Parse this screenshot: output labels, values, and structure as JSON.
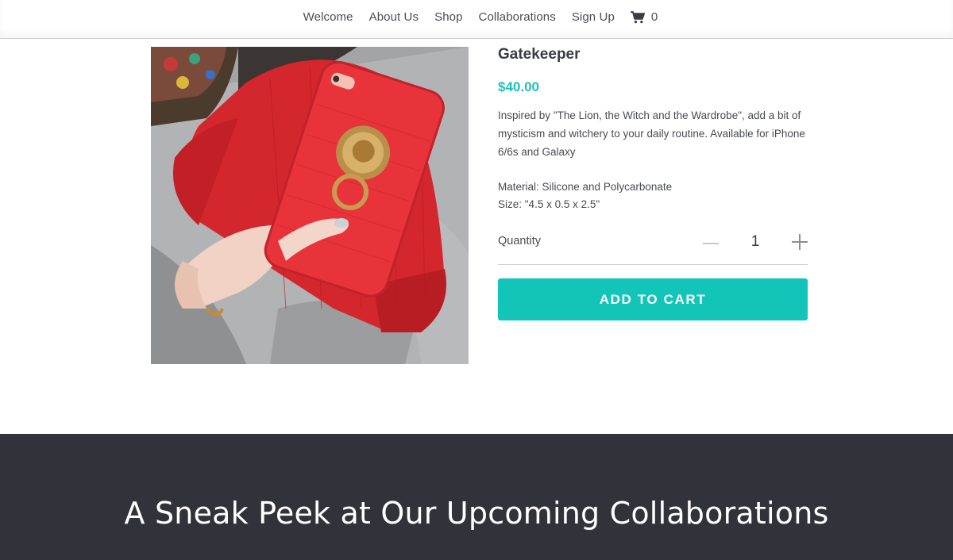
{
  "nav": {
    "links": [
      "Welcome",
      "About Us",
      "Shop",
      "Collaborations",
      "Sign Up"
    ],
    "cart_icon": "shopping-cart-icon",
    "cart_count": "0"
  },
  "product": {
    "image_icon": "product-photo-red-phone-case-lion-ring",
    "title": "Gatekeeper",
    "price": "$40.00",
    "description": "Inspired by \"The Lion, the Witch and the Wardrobe\", add a bit of mysticism and witchery to your daily routine. Available for iPhone 6/6s and Galaxy",
    "material": "Material: Silicone and Polycarbonate",
    "size": "Size: \"4.5 x 0.5 x 2.5\"",
    "quantity_label": "Quantity",
    "quantity_value": "1",
    "add_to_cart_label": "ADD TO CART"
  },
  "colors": {
    "accent": "#13c5b8",
    "price": "#1cc3b9",
    "band_bg": "#30333a"
  },
  "sneak_peek": {
    "heading": "A Sneak Peek at Our Upcoming Collaborations"
  }
}
